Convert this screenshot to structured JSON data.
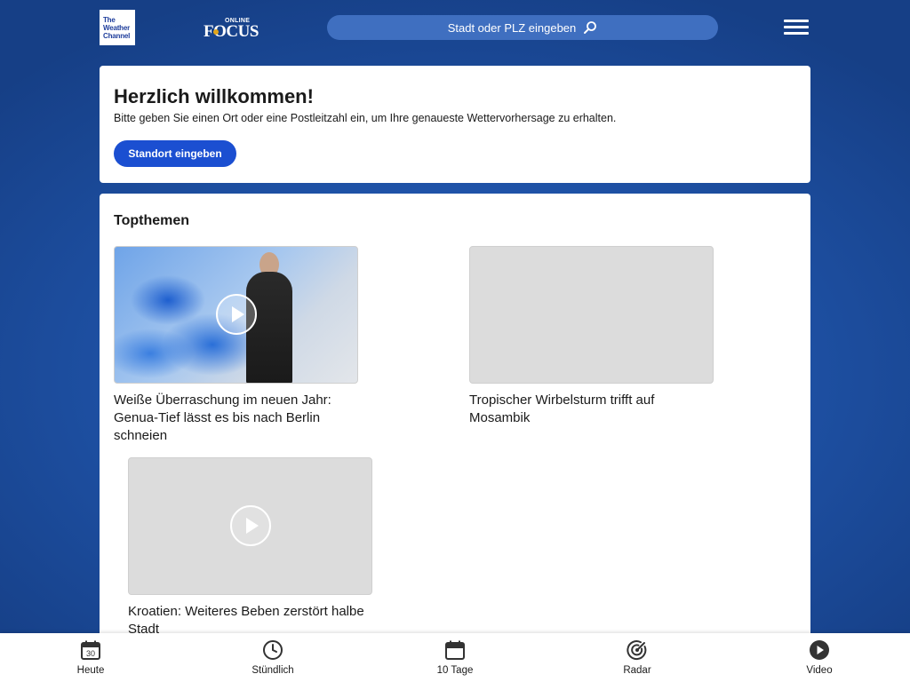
{
  "header": {
    "twc_logo": [
      "The",
      "Weather",
      "Channel"
    ],
    "focus_logo": {
      "online": "ONLINE",
      "word": "FOCUS"
    },
    "search": {
      "placeholder": "Stadt oder PLZ eingeben"
    }
  },
  "welcome": {
    "title": "Herzlich willkommen!",
    "text": "Bitte geben Sie einen Ort oder eine Postleitzahl ein, um Ihre genaueste Wettervorhersage zu erhalten.",
    "button": "Standort eingeben"
  },
  "topics": {
    "title": "Topthemen",
    "articles": [
      {
        "title": "Weiße Überraschung im neuen Jahr: Genua-Tief lässt es bis nach Berlin schneien",
        "video": true
      },
      {
        "title": "Tropischer Wirbelsturm trifft auf Mosambik",
        "video": false
      },
      {
        "title": "Kroatien: Weiteres Beben zerstört halbe Stadt",
        "video": true
      }
    ]
  },
  "bottom_nav": {
    "items": [
      {
        "label": "Heute",
        "icon": "calendar-today-icon",
        "day": "30"
      },
      {
        "label": "Stündlich",
        "icon": "clock-icon"
      },
      {
        "label": "10 Tage",
        "icon": "calendar-icon"
      },
      {
        "label": "Radar",
        "icon": "radar-icon"
      },
      {
        "label": "Video",
        "icon": "play-circle-icon"
      }
    ]
  },
  "colors": {
    "background": "#1f53a8",
    "search_bg": "#3f6fc0",
    "button": "#1b4fd1",
    "card": "#ffffff"
  }
}
